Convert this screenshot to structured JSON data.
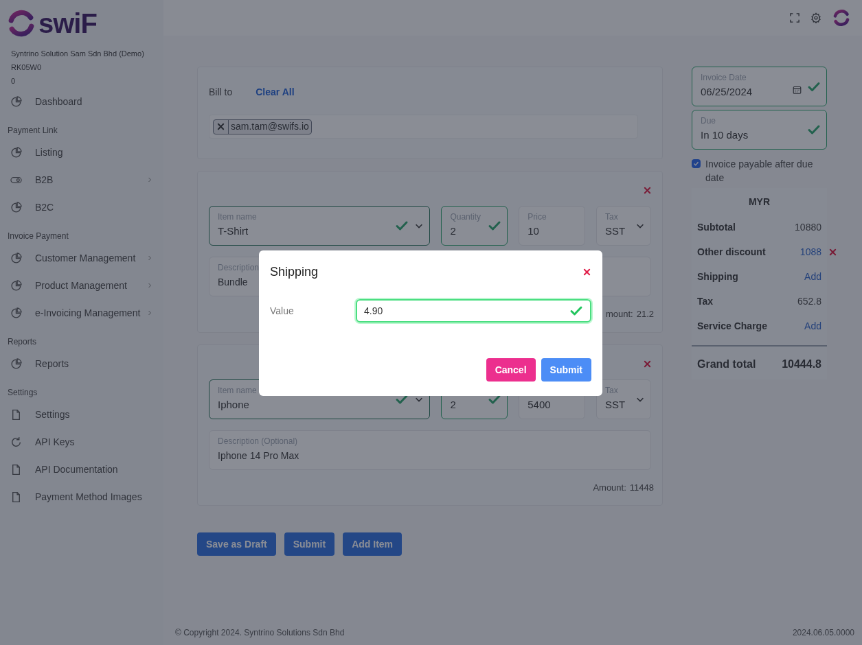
{
  "brand": {
    "logo_text": "swiF"
  },
  "account": {
    "lines": [
      "Syntrino Solution Sam Sdn Bhd (Demo)",
      "RK05W0",
      "0"
    ]
  },
  "sidebar": {
    "sections": [
      {
        "items": [
          {
            "label": "Dashboard",
            "kind": "pie",
            "submenu": false
          }
        ]
      },
      {
        "heading": "Payment Link",
        "items": [
          {
            "label": "Listing",
            "kind": "pie",
            "submenu": false
          },
          {
            "label": "B2B",
            "kind": "toggle",
            "submenu": true
          },
          {
            "label": "B2C",
            "kind": "pie",
            "submenu": false
          }
        ]
      },
      {
        "heading": "Invoice Payment",
        "items": [
          {
            "label": "Customer Management",
            "kind": "pie",
            "submenu": true
          },
          {
            "label": "Product Management",
            "kind": "pie",
            "submenu": true
          },
          {
            "label": "e-Invoicing Management",
            "kind": "pie",
            "submenu": true
          }
        ]
      },
      {
        "heading": "Reports",
        "items": [
          {
            "label": "Reports",
            "kind": "pie",
            "submenu": false
          }
        ]
      },
      {
        "heading": "Settings",
        "items": [
          {
            "label": "Settings",
            "kind": "file",
            "submenu": false
          },
          {
            "label": "API Keys",
            "kind": "refresh",
            "submenu": false
          },
          {
            "label": "API Documentation",
            "kind": "file",
            "submenu": false
          },
          {
            "label": "Payment Method Images",
            "kind": "file",
            "submenu": false
          }
        ]
      }
    ]
  },
  "bill_to": {
    "label": "Bill to",
    "clear_link": "Clear All",
    "recipients": [
      "sam.tam@swifs.io"
    ]
  },
  "items": [
    {
      "name_label": "Item name",
      "name": "T-Shirt",
      "name_valid": true,
      "quantity_label": "Quantity",
      "quantity": "2",
      "quantity_valid": true,
      "price_label": "Price",
      "price": "10",
      "tax_label": "Tax",
      "tax": "SST",
      "description_label": "Description",
      "description": "Bundle",
      "amount_label": "mount:",
      "amount": "21.2"
    },
    {
      "name_label": "Item name",
      "name": "Iphone",
      "name_valid": true,
      "quantity": "2",
      "quantity_valid": true,
      "price": "5400",
      "tax_label": "Tax",
      "tax": "SST",
      "description_label": "Description (Optional)",
      "description": "Iphone 14 Pro Max",
      "amount_label": "Amount:",
      "amount": "11448"
    }
  ],
  "actions": [
    "Save as Draft",
    "Submit",
    "Add Item"
  ],
  "invoice_date": {
    "label": "Invoice Date",
    "value": "06/25/2024",
    "valid": true
  },
  "due": {
    "label": "Due",
    "value": "In 10 days",
    "valid": true
  },
  "payable_after_due": {
    "label": "Invoice payable after due date",
    "checked": true
  },
  "summary": {
    "currency": "MYR",
    "rows": [
      {
        "label": "Subtotal",
        "value": "10880",
        "kind": "text",
        "removable": false
      },
      {
        "label": "Other discount",
        "value": "1088",
        "kind": "link",
        "removable": true
      },
      {
        "label": "Shipping",
        "value": "Add",
        "kind": "link",
        "removable": false
      },
      {
        "label": "Tax",
        "value": "652.8",
        "kind": "text",
        "removable": false
      },
      {
        "label": "Service Charge",
        "value": "Add",
        "kind": "link",
        "removable": false
      }
    ],
    "total_label": "Grand total",
    "total": "10444.8"
  },
  "footer": {
    "copyright": "© Copyright 2024. Syntrino Solutions Sdn Bhd",
    "version": "2024.06.05.0000"
  },
  "dialog": {
    "title": "Shipping",
    "field_label": "Value",
    "field_value": "4.90",
    "field_valid": true,
    "buttons": [
      {
        "label": "Cancel",
        "kind": "cancel"
      },
      {
        "label": "Submit",
        "kind": "primary"
      }
    ]
  }
}
